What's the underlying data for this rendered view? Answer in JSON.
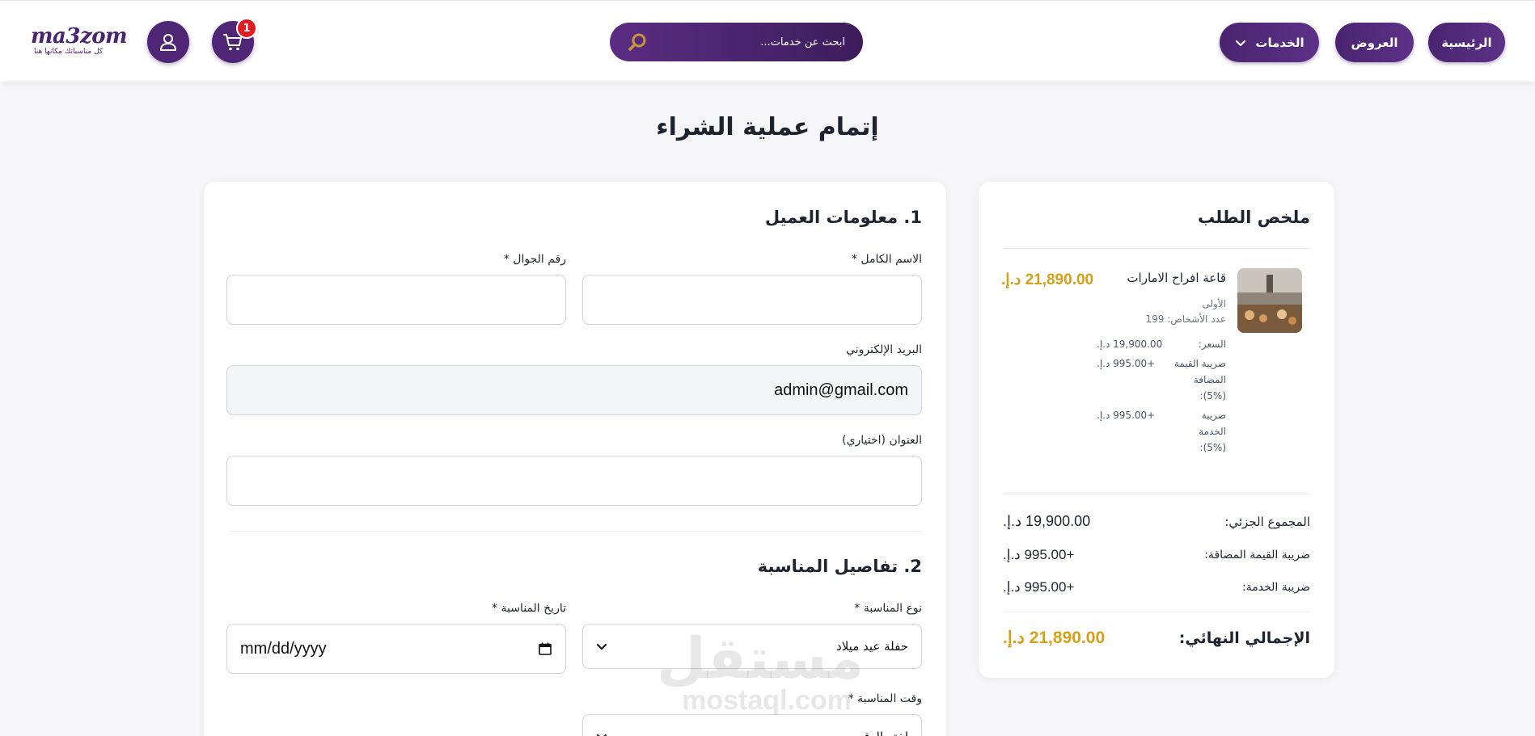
{
  "header": {
    "nav": {
      "home_label": "الرئيسية",
      "offers_label": "العروض",
      "services_label": "الخدمات"
    },
    "search": {
      "placeholder": "ابحث عن خدمات..."
    },
    "cart": {
      "count": "1"
    },
    "logo": {
      "word": "ma3zom",
      "tagline": "كل مناسباتك مكانها هنا"
    }
  },
  "page": {
    "title": "إتمام عملية الشراء"
  },
  "form": {
    "section1_title": "1. معلومات العميل",
    "full_name_label": "الاسم الكامل *",
    "full_name_value": "",
    "phone_label": "رقم الجوال *",
    "phone_value": "",
    "email_label": "البريد الإلكتروني",
    "email_value": "admin@gmail.com",
    "address_label": "العنوان (اختياري)",
    "address_value": "",
    "section2_title": "2. تفاصيل المناسبة",
    "event_type_label": "نوع المناسبة *",
    "event_type_value": "حفلة عيد ميلاد",
    "event_date_label": "تاريخ المناسبة *",
    "event_date_value": "mm/dd/yyyy",
    "event_time_label": "وقت المناسبة *",
    "event_time_value": "اختر الوقت"
  },
  "summary": {
    "title": "ملخص الطلب",
    "item": {
      "name": "قاعة افراح الامارات",
      "price": "21,890.00 د.إ.",
      "tier": "الأولى",
      "guests": "عدد الأشخاص: 199",
      "price_label": "السعر:",
      "price_value": "19,900.00 د.إ.",
      "vat_label_1": "ضريبة القيمة",
      "vat_label_2": "المضافة",
      "vat_label_3": "(5%):",
      "vat_value": "+995.00 د.إ.",
      "service_label_1": "ضريبة",
      "service_label_2": "الخدمة",
      "service_label_3": "(5%):",
      "service_value": "+995.00 د.إ."
    },
    "subtotal_label": "المجموع الجزئي:",
    "subtotal_value": "19,900.00 د.إ.",
    "vat_label": "ضريبة القيمة المضافة:",
    "vat_value": "+995.00 د.إ.",
    "service_label": "ضريبة الخدمة:",
    "service_value": "+995.00 د.إ.",
    "final_label": "الإجمالي النهائي:",
    "final_value": "21,890.00 د.إ."
  },
  "watermark": {
    "arabic": "مستقل",
    "latin": "mostaql.com"
  },
  "colors": {
    "brand_purple": "#4e2675",
    "accent_gold": "#d4a017",
    "badge_red": "#e21b23"
  }
}
